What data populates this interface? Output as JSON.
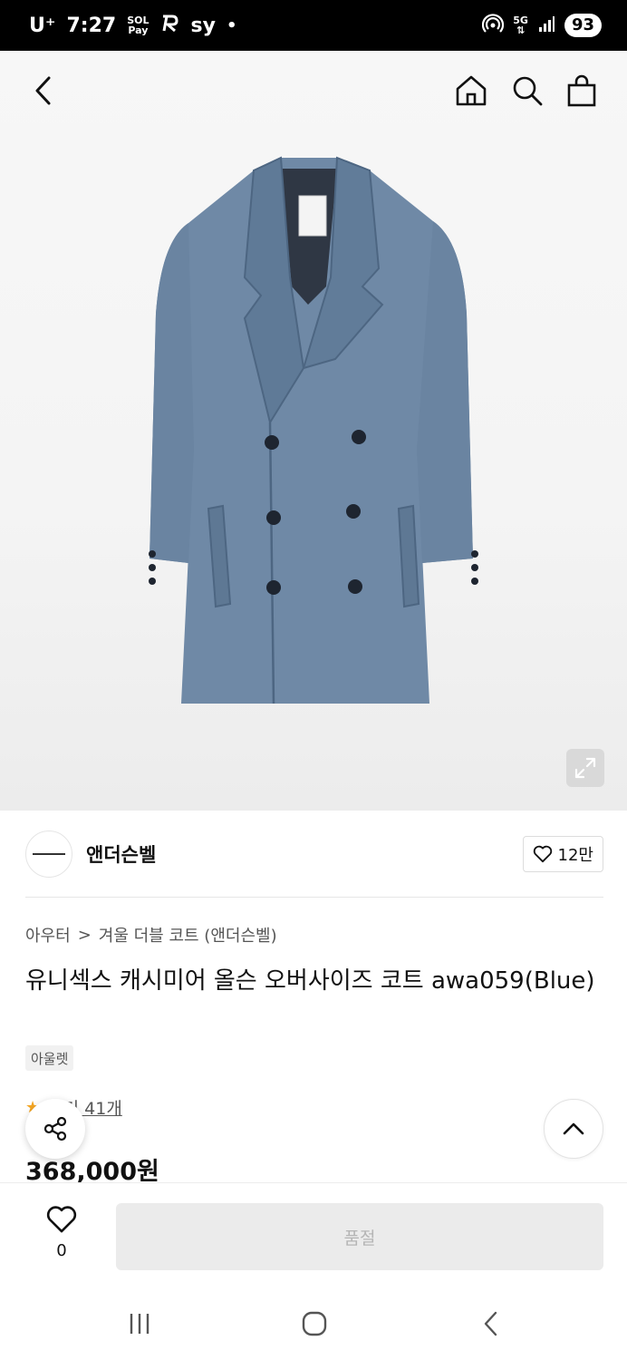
{
  "status_bar": {
    "carrier": "U⁺",
    "time": "7:27",
    "pay_top": "SOL",
    "pay_bottom": "Pay",
    "app_badge": "sy",
    "dot": "•",
    "network_top": "5G",
    "network_bottom": "⇅",
    "battery": "93"
  },
  "header": {
    "back_icon": "chevron-left-icon",
    "home_icon": "home-icon",
    "search_icon": "search-icon",
    "bag_icon": "shopping-bag-icon"
  },
  "brand": {
    "name": "앤더슨벨",
    "like_count": "12만"
  },
  "breadcrumb": {
    "category": "아우터",
    "separator": ">",
    "subcategory": "겨울 더블 코트 (앤더슨벨)"
  },
  "product": {
    "title": "유니섹스 캐시미어 올슨 오버사이즈 코트 awa059(Blue)",
    "tag": "아울렛",
    "review_label": "후기 41개",
    "price": "368,000원"
  },
  "bottom_bar": {
    "wish_count": "0",
    "buy_label": "품절"
  },
  "colors": {
    "coat": "#6f89a6",
    "soldout_bg": "#ebebeb",
    "star": "#f5a623"
  }
}
